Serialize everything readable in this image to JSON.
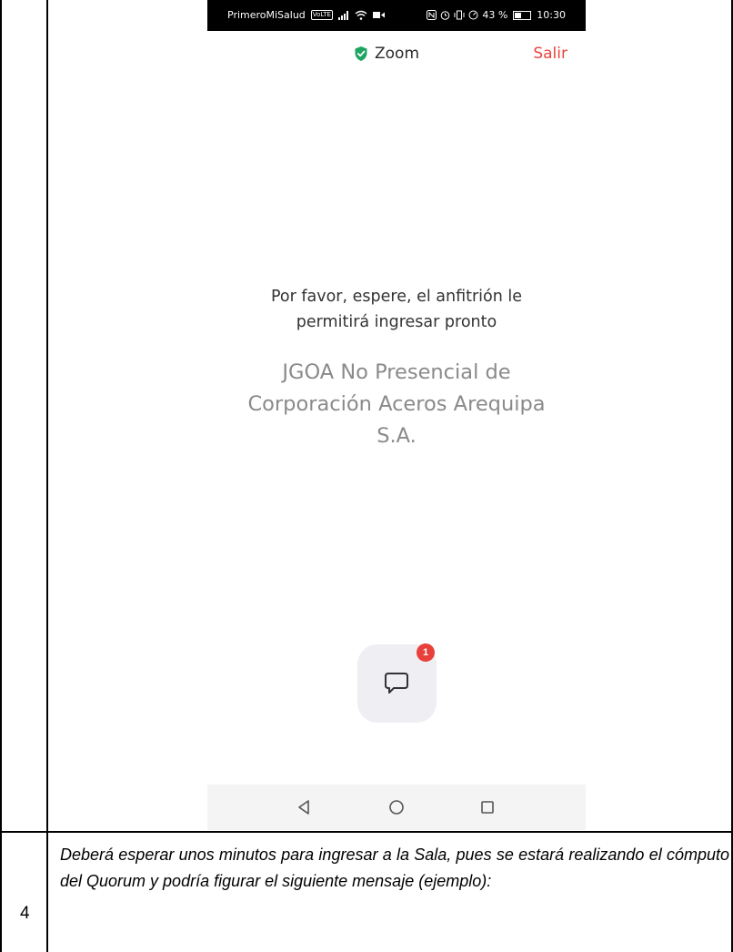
{
  "status_bar": {
    "carrier": "PrimeroMiSalud",
    "volte": "VoLTE",
    "battery_percent": "43 %",
    "time": "10:30",
    "battery_level": 0.43
  },
  "header": {
    "title": "Zoom",
    "leave_label": "Salir",
    "shield_color": "#1fa463",
    "leave_color": "#e8453c"
  },
  "main": {
    "waiting_message": [
      "Por favor, espere, el anfitrión le",
      "permitirá ingresar pronto"
    ],
    "meeting_name": [
      "JGOA No Presencial de",
      "Corporación Aceros Arequipa",
      "S.A."
    ]
  },
  "chat": {
    "badge_count": "1"
  },
  "nav_bar": {
    "icons": [
      "back-icon",
      "home-icon",
      "recents-icon"
    ]
  },
  "document": {
    "step_number": "4",
    "description": "Deberá esperar unos minutos para ingresar a la Sala, pues se estará realizando el cómputo del Quorum y podría figurar el siguiente mensaje (ejemplo):"
  }
}
